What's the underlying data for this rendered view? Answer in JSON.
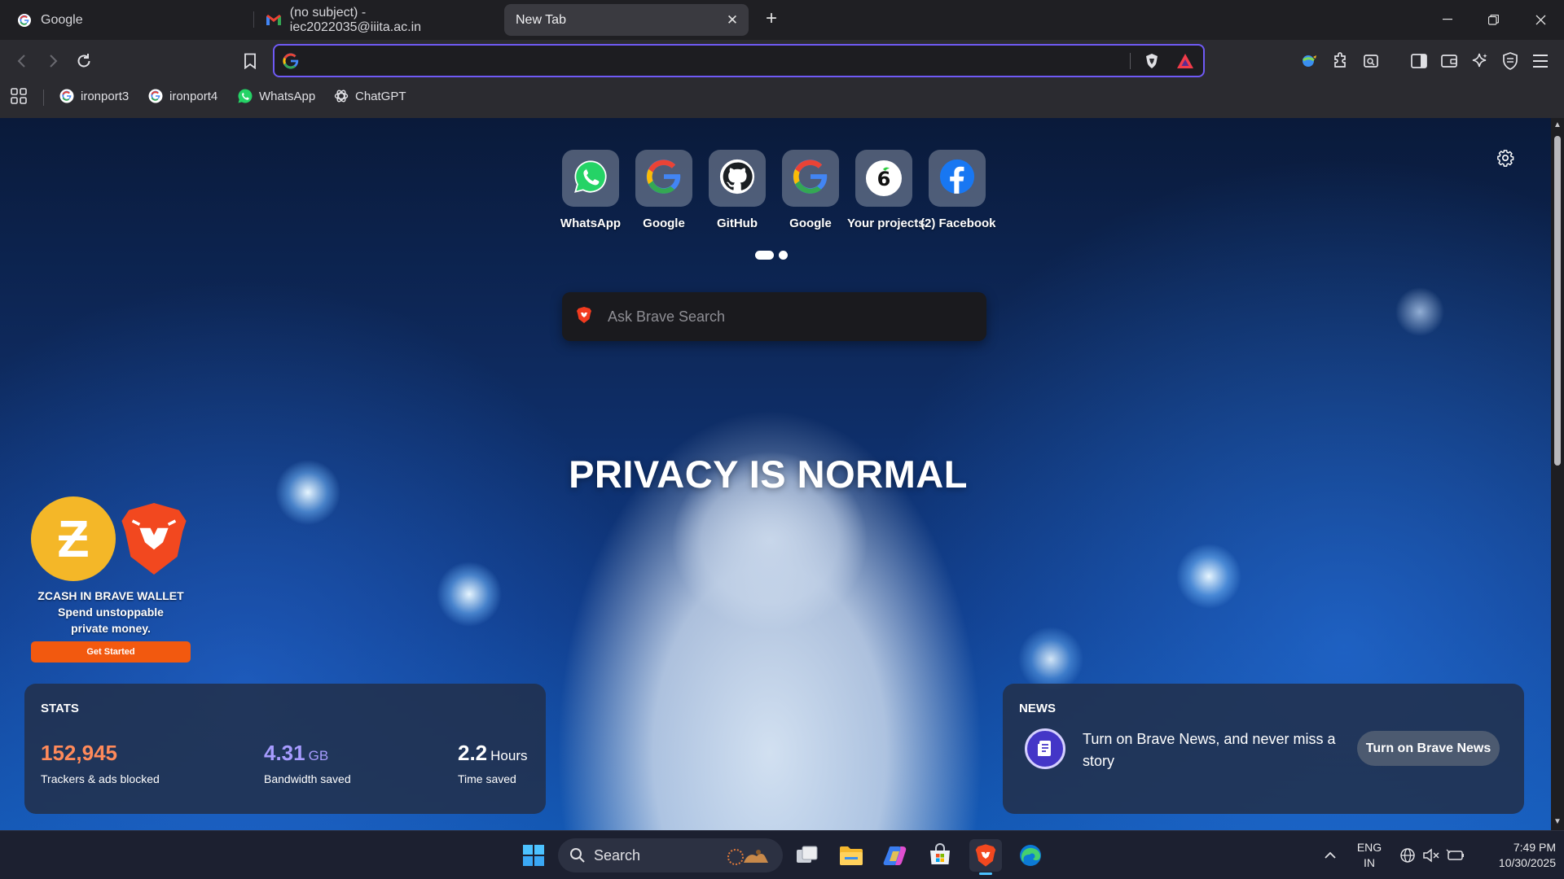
{
  "tabs": [
    {
      "title": "Google",
      "icon": "google-icon"
    },
    {
      "title": "(no subject) - iec2022035@iiita.ac.in",
      "icon": "gmail-icon"
    },
    {
      "title": "New Tab",
      "icon": "",
      "active": true
    }
  ],
  "address_bar": {
    "value": "",
    "placeholder": ""
  },
  "bookmarks": [
    {
      "label": "ironport3",
      "icon": "google-icon"
    },
    {
      "label": "ironport4",
      "icon": "google-icon"
    },
    {
      "label": "WhatsApp",
      "icon": "whatsapp-icon"
    },
    {
      "label": "ChatGPT",
      "icon": "chatgpt-icon"
    }
  ],
  "top_sites": [
    {
      "label": "WhatsApp",
      "icon": "whatsapp-icon"
    },
    {
      "label": "Google",
      "icon": "google-icon"
    },
    {
      "label": "GitHub",
      "icon": "github-icon"
    },
    {
      "label": "Google",
      "icon": "google-icon"
    },
    {
      "label": "Your projects",
      "icon": "project-icon"
    },
    {
      "label": "(2) Facebook",
      "icon": "facebook-icon"
    }
  ],
  "search": {
    "placeholder": "Ask Brave Search"
  },
  "hero": {
    "text": "PRIVACY IS NORMAL"
  },
  "promo": {
    "line1": "ZCASH IN BRAVE WALLET",
    "line2": "Spend unstoppable",
    "line3": "private money.",
    "button": "Get Started"
  },
  "stats": {
    "title": "STATS",
    "trackers": {
      "value": "152,945",
      "caption": "Trackers & ads blocked"
    },
    "bandwidth": {
      "value": "4.31",
      "unit": "GB",
      "caption": "Bandwidth saved"
    },
    "time": {
      "value": "2.2",
      "unit": "Hours",
      "caption": "Time saved"
    }
  },
  "news": {
    "title": "NEWS",
    "text": "Turn on Brave News, and never miss a story",
    "button": "Turn on Brave News"
  },
  "taskbar": {
    "search_label": "Search",
    "lang_line1": "ENG",
    "lang_line2": "IN",
    "time": "7:49 PM",
    "date": "10/30/2025"
  },
  "colors": {
    "accent": "#6f5af5",
    "brave_orange": "#f2590f",
    "tracker_orange": "#ff8a5a",
    "bandwidth_purple": "#a79cff",
    "zcash_yellow": "#f4b728"
  }
}
